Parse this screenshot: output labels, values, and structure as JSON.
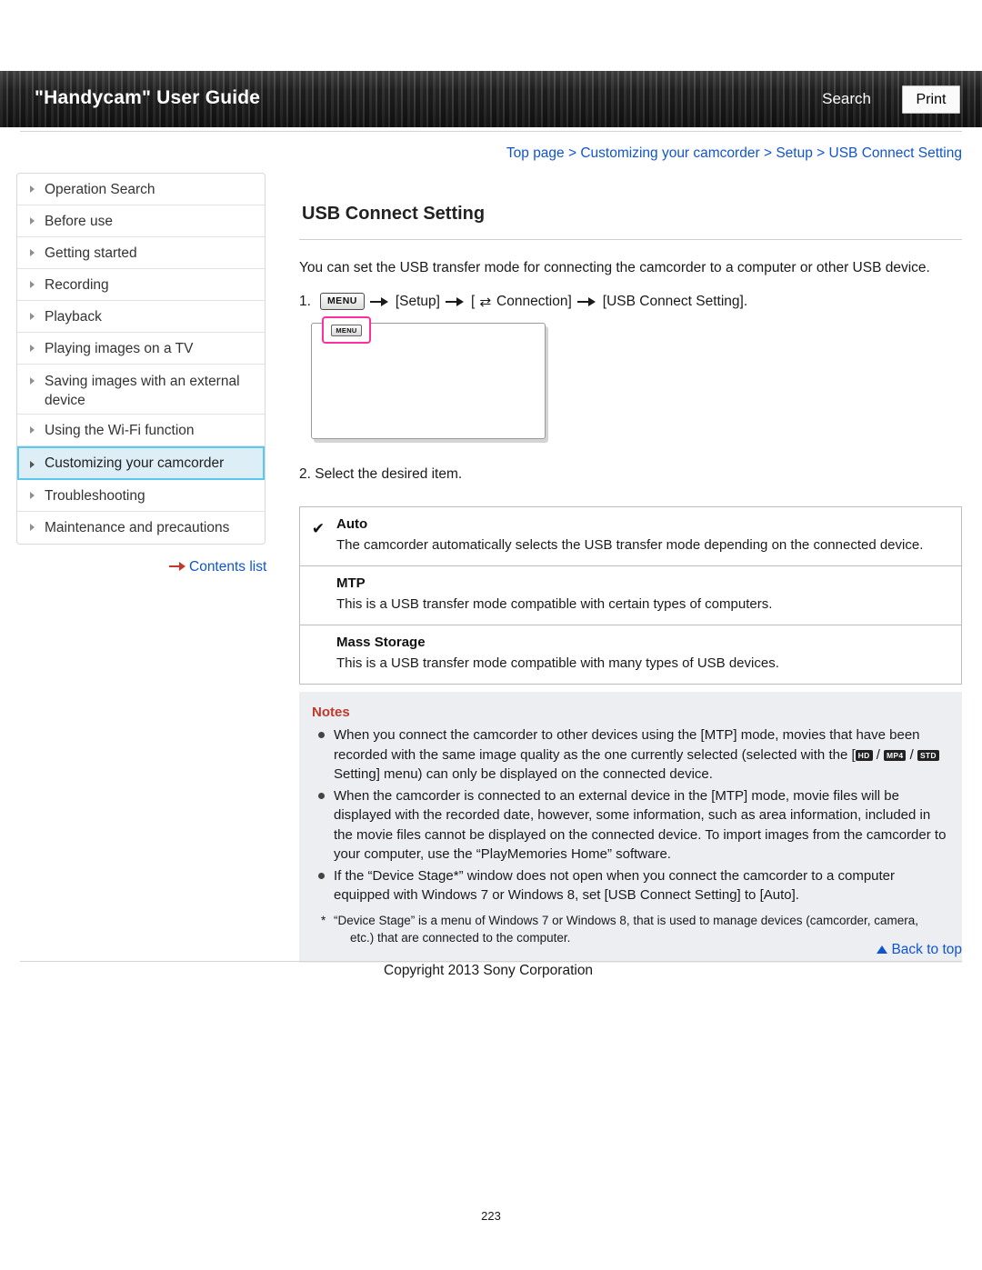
{
  "header": {
    "title": "\"Handycam\" User Guide",
    "search_label": "Search",
    "print_label": "Print"
  },
  "breadcrumb": {
    "items": [
      "Top page",
      "Customizing your camcorder",
      "Setup",
      "USB Connect Setting"
    ],
    "separator": ">"
  },
  "sidebar": {
    "items": [
      {
        "label": "Operation Search",
        "active": false
      },
      {
        "label": "Before use",
        "active": false
      },
      {
        "label": "Getting started",
        "active": false
      },
      {
        "label": "Recording",
        "active": false
      },
      {
        "label": "Playback",
        "active": false
      },
      {
        "label": "Playing images on a TV",
        "active": false
      },
      {
        "label": "Saving images with an external device",
        "active": false
      },
      {
        "label": "Using the Wi-Fi function",
        "active": false
      },
      {
        "label": "Customizing your camcorder",
        "active": true
      },
      {
        "label": "Troubleshooting",
        "active": false
      },
      {
        "label": "Maintenance and precautions",
        "active": false
      }
    ],
    "contents_list_label": "Contents list"
  },
  "main": {
    "page_title": "USB Connect Setting",
    "intro": "You can set the USB transfer mode for connecting the camcorder to a computer or other USB device.",
    "step1": {
      "number": "1.",
      "menu_chip": "MENU",
      "part_setup": "[Setup]",
      "bracket_open": "[",
      "connection_label": "Connection]",
      "connection_icon": "⇄",
      "part_usb": "[USB Connect Setting]."
    },
    "illustration": {
      "menu_button_label": "MENU"
    },
    "step2": "2. Select the desired item.",
    "options": [
      {
        "checked": true,
        "check_glyph": "✔",
        "name": "Auto",
        "desc": "The camcorder automatically selects the USB transfer mode depending on the connected device."
      },
      {
        "checked": false,
        "check_glyph": "",
        "name": "MTP",
        "desc": "This is a USB transfer mode compatible with certain types of computers."
      },
      {
        "checked": false,
        "check_glyph": "",
        "name": "Mass Storage",
        "desc": "This is a USB transfer mode compatible with many types of USB devices."
      }
    ]
  },
  "notes": {
    "title": "Notes",
    "items": [
      {
        "text_a": "When you connect the camcorder to other devices using the [MTP] mode, movies that have been recorded with the same image quality as the one currently selected (selected with the [",
        "badge1": "HD",
        "sep1": " / ",
        "badge2": "MP4",
        "sep2": " / ",
        "badge3": "STD",
        "text_b": " Setting] menu) can only be displayed on the connected device."
      },
      {
        "text_a": "When the camcorder is connected to an external device in the [MTP] mode, movie files will be displayed with the recorded date, however, some information, such as area information, included in the movie files cannot be displayed on the connected device. To import images from the camcorder to your computer, use the “PlayMemories Home” software."
      },
      {
        "text_a": "If the “Device Stage*” window does not open when you connect the camcorder to a computer equipped with Windows 7 or Windows 8, set [USB Connect Setting] to [Auto]."
      }
    ],
    "footnote_star": "*",
    "footnote_line1": "“Device Stage” is a menu of Windows 7 or Windows 8, that is used to manage devices (camcorder, camera,",
    "footnote_line2": "etc.) that are connected to the computer."
  },
  "footer": {
    "back_to_top": "Back to top",
    "copyright": "Copyright 2013 Sony Corporation",
    "page_number": "223"
  }
}
